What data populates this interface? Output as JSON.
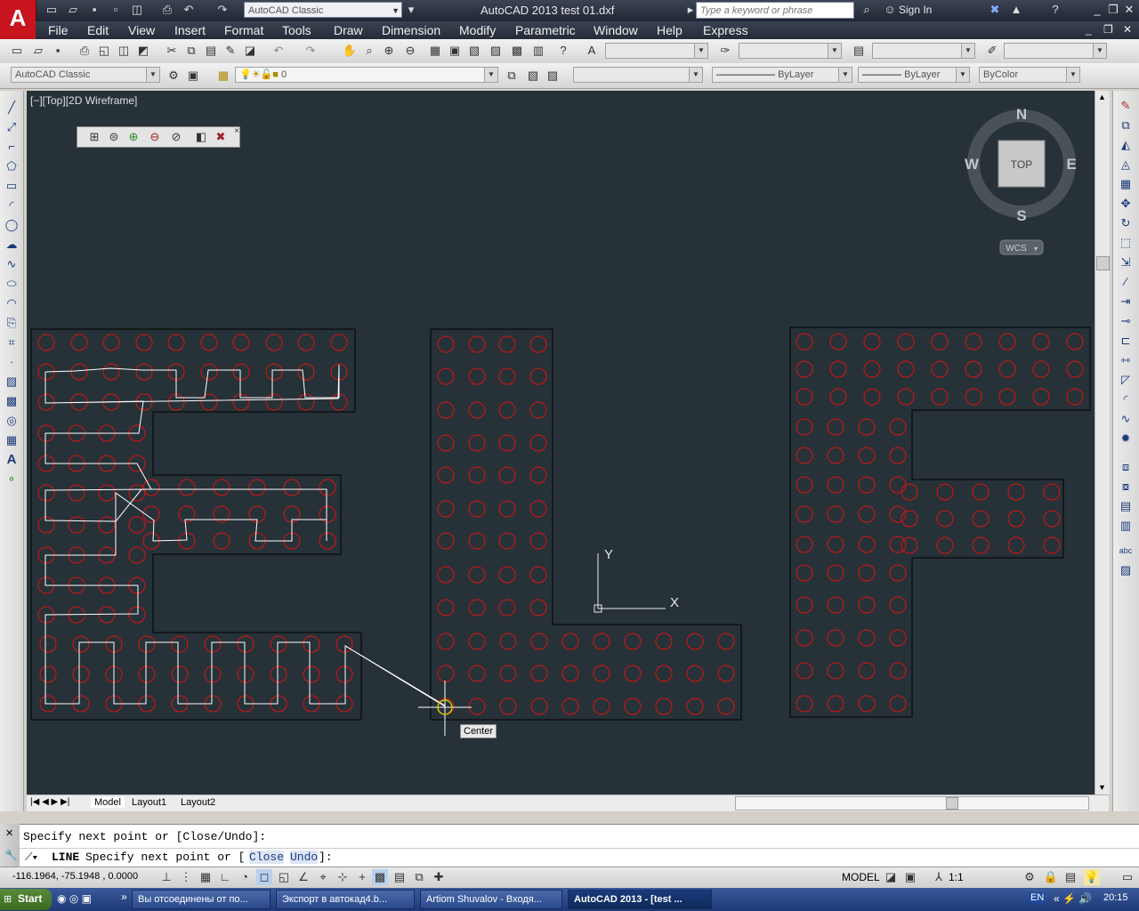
{
  "app": {
    "logo_letter": "A",
    "title": "AutoCAD 2013    test 01.dxf",
    "workspace": "AutoCAD Classic",
    "search_placeholder": "Type a keyword or phrase",
    "sign_in": "Sign In"
  },
  "menus": [
    "File",
    "Edit",
    "View",
    "Insert",
    "Format",
    "Tools",
    "Draw",
    "Dimension",
    "Modify",
    "Parametric",
    "Window",
    "Help",
    "Express"
  ],
  "toolbar2": {
    "workspace": "AutoCAD Classic",
    "layer": "0",
    "linetype": "ByLayer",
    "lineweight": "ByLayer",
    "color": "ByColor"
  },
  "viewport": {
    "label": "[−][Top][2D Wireframe]",
    "viewcube_top": "TOP",
    "compass": {
      "n": "N",
      "s": "S",
      "e": "E",
      "w": "W"
    },
    "wcs": "WCS",
    "ucs_x": "X",
    "ucs_y": "Y",
    "snap_tooltip": "Center"
  },
  "layout_tabs": [
    "Model",
    "Layout1",
    "Layout2"
  ],
  "command": {
    "history": "Specify next point or [Close/Undo]:",
    "prompt_cmd": "LINE",
    "prompt_text": "Specify next point or [",
    "opt_close": "Close",
    "opt_undo": "Undo",
    "prompt_end": "]:"
  },
  "status": {
    "coords": "-116.1964, -75.1948 , 0.0000",
    "model": "MODEL",
    "scale": "1:1"
  },
  "taskbar": {
    "start": "Start",
    "tasks": [
      "Вы отсоединены от по...",
      "Экспорт в автокад4.b...",
      "Artiom Shuvalov - Входя...",
      "AutoCAD 2013 - [test ..."
    ],
    "lang": "EN",
    "clock": "20:15"
  },
  "colors": {
    "canvas_bg": "#263238",
    "circle": "#e01010",
    "path": "#ffffff"
  }
}
